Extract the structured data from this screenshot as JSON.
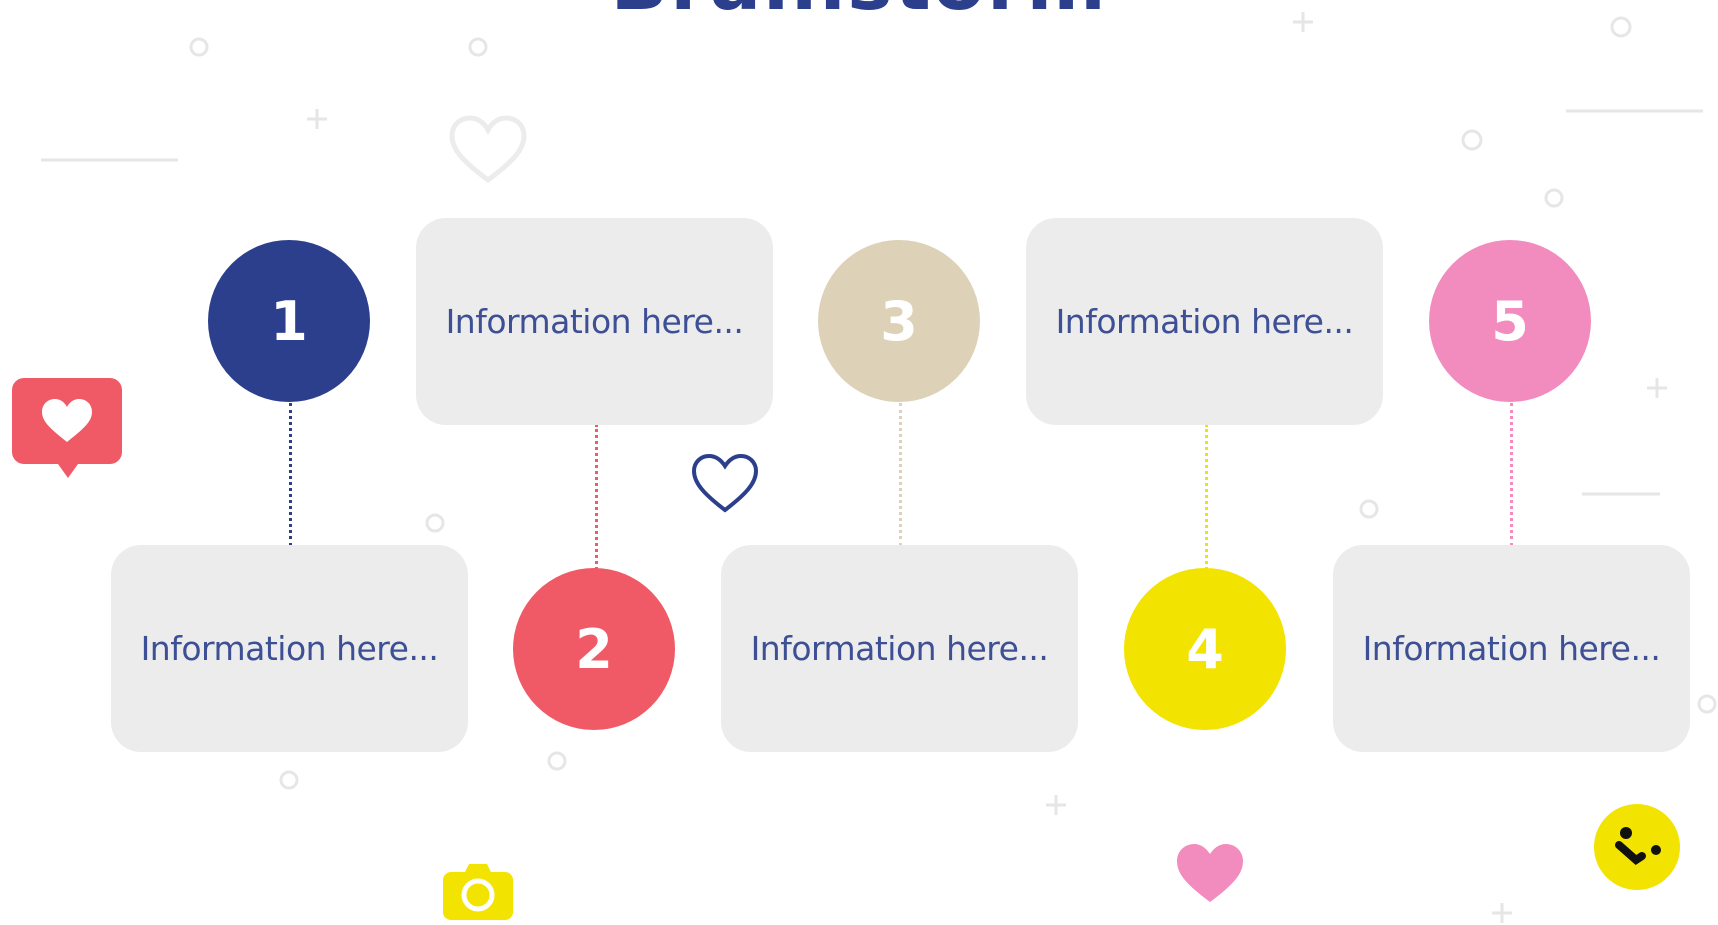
{
  "title": "Brainstorm",
  "steps": [
    {
      "number": "1",
      "text": "Information here...",
      "color": "#2b3f8c"
    },
    {
      "number": "2",
      "text": "Information here...",
      "color": "#f05a67"
    },
    {
      "number": "3",
      "text": "Information here...",
      "color": "#ddd2b7"
    },
    {
      "number": "4",
      "text": "Information here...",
      "color": "#f2e300"
    },
    {
      "number": "5",
      "text": "Information here...",
      "color": "#f28cbf"
    }
  ],
  "colors": {
    "card": "#ececec",
    "text": "#3d4f95",
    "decoration": "#e6e6e6"
  },
  "icons": [
    "heart-chat-bubble-icon",
    "heart-outline-icon",
    "heart-filled-icon",
    "camera-icon",
    "trackpad-badge-icon"
  ]
}
